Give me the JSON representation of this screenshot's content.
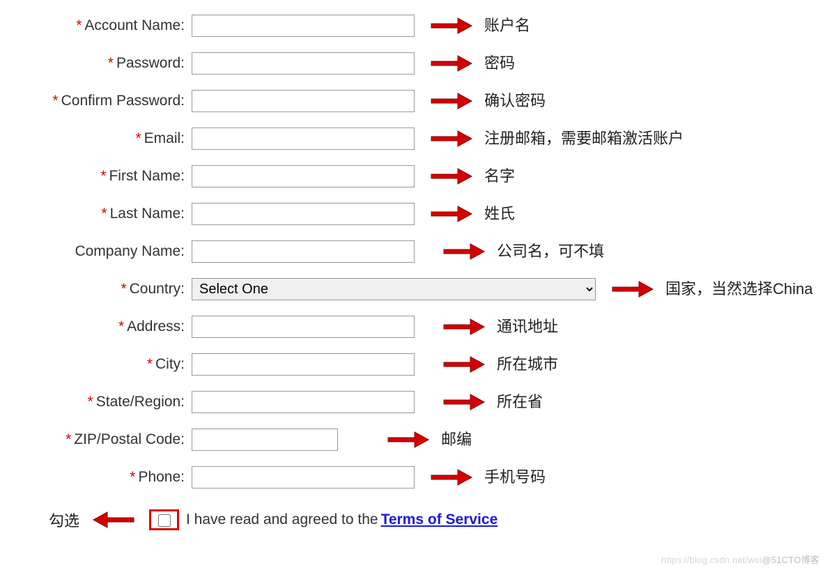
{
  "fields": {
    "account": {
      "label": "Account Name:",
      "required": true,
      "anno": "账户名"
    },
    "password": {
      "label": "Password:",
      "required": true,
      "anno": "密码"
    },
    "confirm": {
      "label": "Confirm Password:",
      "required": true,
      "anno": "确认密码"
    },
    "email": {
      "label": "Email:",
      "required": true,
      "anno": "注册邮箱，需要邮箱激活账户"
    },
    "first": {
      "label": "First Name:",
      "required": true,
      "anno": "名字"
    },
    "last": {
      "label": "Last Name:",
      "required": true,
      "anno": "姓氏"
    },
    "company": {
      "label": "Company Name:",
      "required": false,
      "anno": "公司名，可不填"
    },
    "country": {
      "label": "Country:",
      "required": true,
      "selected": "Select One",
      "anno": "国家，当然选择China"
    },
    "address": {
      "label": "Address:",
      "required": true,
      "anno": "通讯地址"
    },
    "city": {
      "label": "City:",
      "required": true,
      "anno": "所在城市"
    },
    "state": {
      "label": "State/Region:",
      "required": true,
      "anno": "所在省"
    },
    "zip": {
      "label": "ZIP/Postal Code:",
      "required": true,
      "anno": "邮编"
    },
    "phone": {
      "label": "Phone:",
      "required": true,
      "anno": "手机号码"
    }
  },
  "required_char": "*",
  "tos": {
    "anno": "勾选",
    "text": "I have read and agreed to the ",
    "link": "Terms of Service"
  },
  "watermark": {
    "part1": "https://blog.csdn.net/wei",
    "part2": "@51CTO博客"
  }
}
